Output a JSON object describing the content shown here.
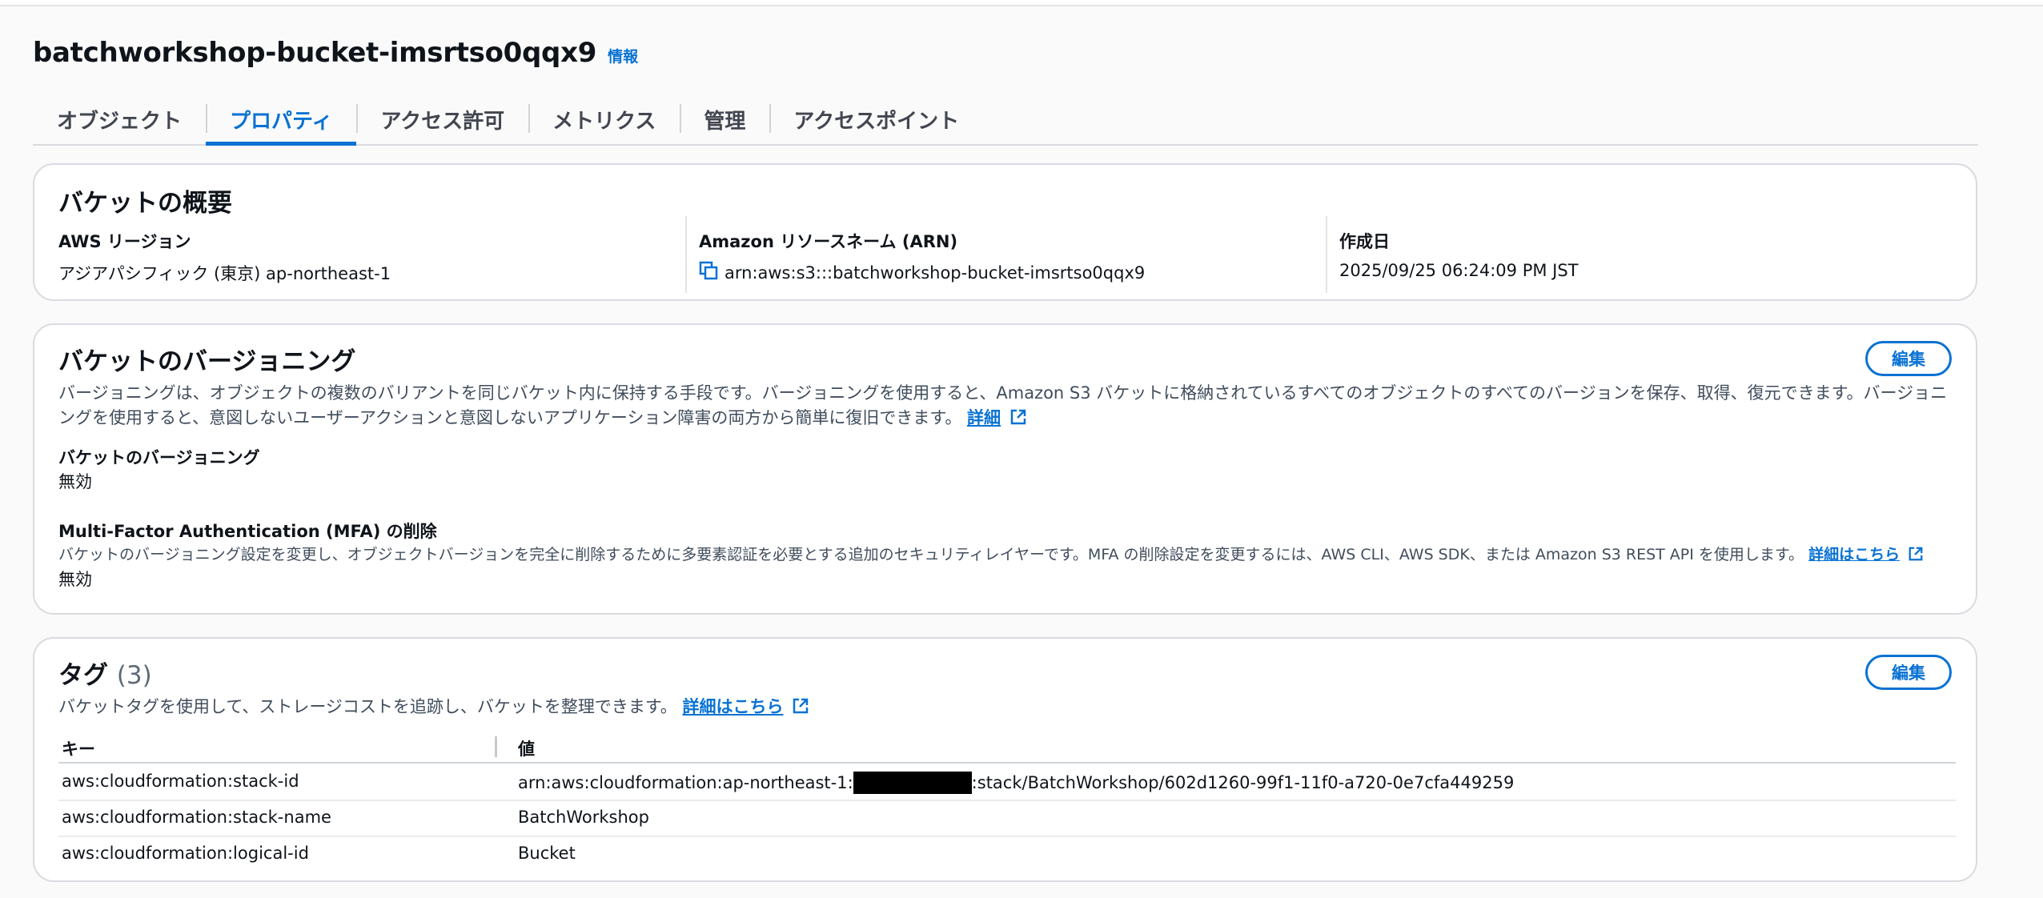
{
  "header": {
    "bucket_name": "batchworkshop-bucket-imsrtso0qqx9",
    "info_label": "情報"
  },
  "tabs": [
    {
      "label": "オブジェクト",
      "active": false
    },
    {
      "label": "プロパティ",
      "active": true
    },
    {
      "label": "アクセス許可",
      "active": false
    },
    {
      "label": "メトリクス",
      "active": false
    },
    {
      "label": "管理",
      "active": false
    },
    {
      "label": "アクセスポイント",
      "active": false
    }
  ],
  "overview": {
    "title": "バケットの概要",
    "region_label": "AWS リージョン",
    "region_value": "アジアパシフィック (東京) ap-northeast-1",
    "arn_label": "Amazon リソースネーム (ARN)",
    "arn_value": "arn:aws:s3:::batchworkshop-bucket-imsrtso0qqx9",
    "created_label": "作成日",
    "created_value": "2025/09/25 06:24:09 PM JST"
  },
  "versioning": {
    "title": "バケットのバージョニング",
    "edit_label": "編集",
    "description": "バージョニングは、オブジェクトの複数のバリアントを同じバケット内に保持する手段です。バージョニングを使用すると、Amazon S3 バケットに格納されているすべてのオブジェクトのすべてのバージョンを保存、取得、復元できます。バージョニングを使用すると、意図しないユーザーアクションと意図しないアプリケーション障害の両方から簡単に復旧できます。",
    "learn_more": "詳細",
    "status_label": "バケットのバージョニング",
    "status_value": "無効",
    "mfa_label": "Multi-Factor Authentication (MFA) の削除",
    "mfa_description": "バケットのバージョニング設定を変更し、オブジェクトバージョンを完全に削除するために多要素認証を必要とする追加のセキュリティレイヤーです。MFA の削除設定を変更するには、AWS CLI、AWS SDK、または Amazon S3 REST API を使用します。",
    "mfa_learn_more": "詳細はこちら",
    "mfa_value": "無効"
  },
  "tags": {
    "title": "タグ",
    "count": "(3)",
    "edit_label": "編集",
    "description": "バケットタグを使用して、ストレージコストを追跡し、バケットを整理できます。",
    "learn_more": "詳細はこちら",
    "col_key": "キー",
    "col_value": "値",
    "rows": [
      {
        "key": "aws:cloudformation:stack-id",
        "value_prefix": "arn:aws:cloudformation:ap-northeast-1:",
        "value_suffix": ":stack/BatchWorkshop/602d1260-99f1-11f0-a720-0e7cfa449259"
      },
      {
        "key": "aws:cloudformation:stack-name",
        "value_prefix": "BatchWorkshop",
        "value_suffix": ""
      },
      {
        "key": "aws:cloudformation:logical-id",
        "value_prefix": "Bucket",
        "value_suffix": ""
      }
    ]
  },
  "colors": {
    "accent": "#0972d3",
    "border": "#d8dbdf",
    "background": "#fafafa"
  }
}
